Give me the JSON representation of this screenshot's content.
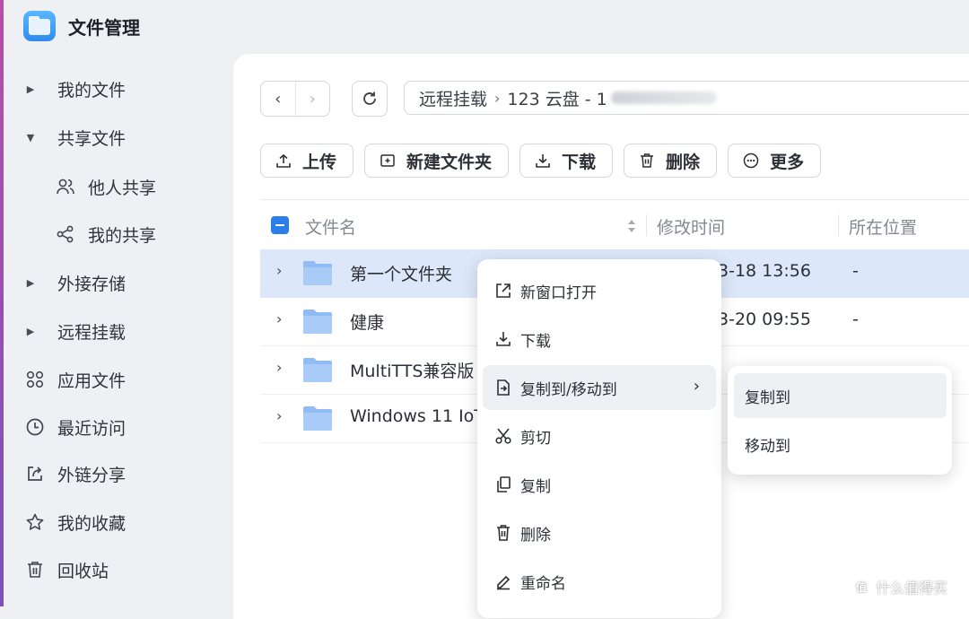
{
  "app": {
    "title": "文件管理",
    "logo_icon": "folder-app-icon"
  },
  "sidebar": {
    "items": [
      {
        "label": "我的文件",
        "state": "collapsed"
      },
      {
        "label": "共享文件",
        "state": "expanded"
      },
      {
        "label": "他人共享",
        "icon": "users-icon"
      },
      {
        "label": "我的共享",
        "icon": "share-icon"
      },
      {
        "label": "外接存储",
        "state": "collapsed"
      },
      {
        "label": "远程挂载",
        "state": "collapsed"
      },
      {
        "label": "应用文件",
        "icon": "apps-grid-icon"
      },
      {
        "label": "最近访问",
        "icon": "clock-icon"
      },
      {
        "label": "外链分享",
        "icon": "external-share-icon"
      },
      {
        "label": "我的收藏",
        "icon": "star-icon"
      },
      {
        "label": "回收站",
        "icon": "trash-icon"
      }
    ]
  },
  "path": {
    "segments": [
      "远程挂载",
      "123 云盘 - 1"
    ]
  },
  "toolbar": {
    "upload": "上传",
    "new_folder": "新建文件夹",
    "download": "下载",
    "delete": "删除",
    "more": "更多"
  },
  "table": {
    "columns": {
      "name": "文件名",
      "mtime": "修改时间",
      "location": "所在位置"
    },
    "rows": [
      {
        "name": "第一个文件夹",
        "mtime": "3-18 13:56",
        "location": "-"
      },
      {
        "name": "健康",
        "mtime": "3-20 09:55",
        "location": "-"
      },
      {
        "name": "MultiTTS兼容版",
        "mtime": "",
        "location": ""
      },
      {
        "name": "Windows 11 IoT",
        "mtime": "",
        "location": ""
      }
    ]
  },
  "context_menu": {
    "items": [
      {
        "label": "新窗口打开",
        "icon": "open-new-window-icon"
      },
      {
        "label": "下载",
        "icon": "download-icon"
      },
      {
        "label": "复制到/移动到",
        "icon": "copy-move-icon"
      },
      {
        "label": "剪切",
        "icon": "scissors-icon"
      },
      {
        "label": "复制",
        "icon": "copy-icon"
      },
      {
        "label": "删除",
        "icon": "trash-icon"
      },
      {
        "label": "重命名",
        "icon": "pencil-icon"
      }
    ]
  },
  "submenu": {
    "items": [
      "复制到",
      "移动到"
    ]
  },
  "watermark": {
    "icon_glyph": "值",
    "text": "什么值得买"
  },
  "colors": {
    "accent": "#2b7de9",
    "selected_row": "#dce8fa",
    "folder": "#8fbcf5"
  }
}
